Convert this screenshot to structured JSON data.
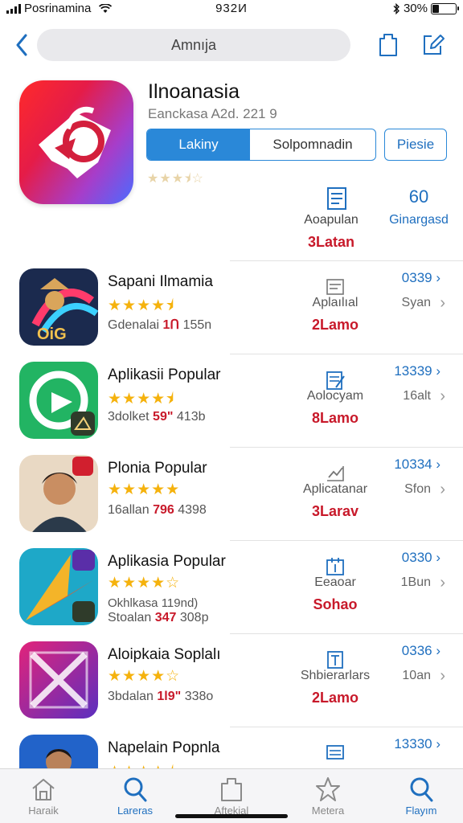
{
  "status": {
    "carrier": "Posrinamina",
    "time": "932И",
    "battery": "30%",
    "battery_level": 0.3
  },
  "nav": {
    "search_text": "Amnıja"
  },
  "hero": {
    "title": "Ilnoanasia",
    "subtitle": "Eanckasa A2d. 221 9",
    "segment_left": "Lakiny",
    "segment_right": "Solpomnadin",
    "preview_button": "Piesie",
    "rating": 3.5,
    "stat_left_label": "Aoapulan",
    "stat_left_value": "3Latan",
    "stat_right_number": "60",
    "stat_right_label": "Ginargasd"
  },
  "apps": [
    {
      "name": "Sapani Ilmamia",
      "rating": 4.5,
      "extra": "",
      "meta_left": "Gdenalai",
      "meta_red": "1Ո",
      "meta_right": "155n",
      "right_label": "Aplaılıal",
      "right_red": "2Lamo",
      "right_num": "0339 ›",
      "right_gray": "Syan"
    },
    {
      "name": "Aplikasii Popular",
      "rating": 4.5,
      "extra": "",
      "meta_left": "3dolket",
      "meta_red": "59\"",
      "meta_right": "413b",
      "right_label": "Aolocyam",
      "right_red": "8Lamo",
      "right_num": "13339 ›",
      "right_gray": "16alt"
    },
    {
      "name": "Plonia Popular",
      "rating": 5,
      "extra": "",
      "meta_left": "16allan",
      "meta_red": "796",
      "meta_right": "4398",
      "right_label": "Aplicatanar",
      "right_red": "3Larav",
      "right_num": "10334 ›",
      "right_gray": "Sfon"
    },
    {
      "name": "Aplikasia Popular",
      "rating": 4,
      "extra": "Okhlkasa 119nd)",
      "meta_left": "Stoalan",
      "meta_red": "347",
      "meta_right": "308p",
      "right_label": "Eeaoar",
      "right_red": "Sohao",
      "right_num": "0330 ›",
      "right_gray": "1Bun"
    },
    {
      "name": "Aloipkaia Soplalı",
      "rating": 4,
      "extra": "",
      "meta_left": "3bdalan",
      "meta_red": "1l9\"",
      "meta_right": "338o",
      "right_label": "Shbierarlars",
      "right_red": "2Lamo",
      "right_num": "0336 ›",
      "right_gray": "10an"
    },
    {
      "name": "Napelain Popnla",
      "rating": 4.5,
      "extra": "",
      "meta_left": "",
      "meta_red": "",
      "meta_right": "",
      "right_label": "",
      "right_red": "",
      "right_num": "13330 ›",
      "right_gray": ""
    }
  ],
  "tabs": [
    {
      "label": "Haraik",
      "icon": "home-icon",
      "active": false
    },
    {
      "label": "Lareras",
      "icon": "search-icon",
      "active": true
    },
    {
      "label": "Aftekial",
      "icon": "bag-icon",
      "active": false
    },
    {
      "label": "Metera",
      "icon": "star-icon",
      "active": false
    },
    {
      "label": "Flayım",
      "icon": "search-icon",
      "active": true
    }
  ],
  "colors": {
    "accent": "#2a88d8",
    "link": "#1f6fbf",
    "red": "#c8192a",
    "star": "#f5b20d"
  }
}
